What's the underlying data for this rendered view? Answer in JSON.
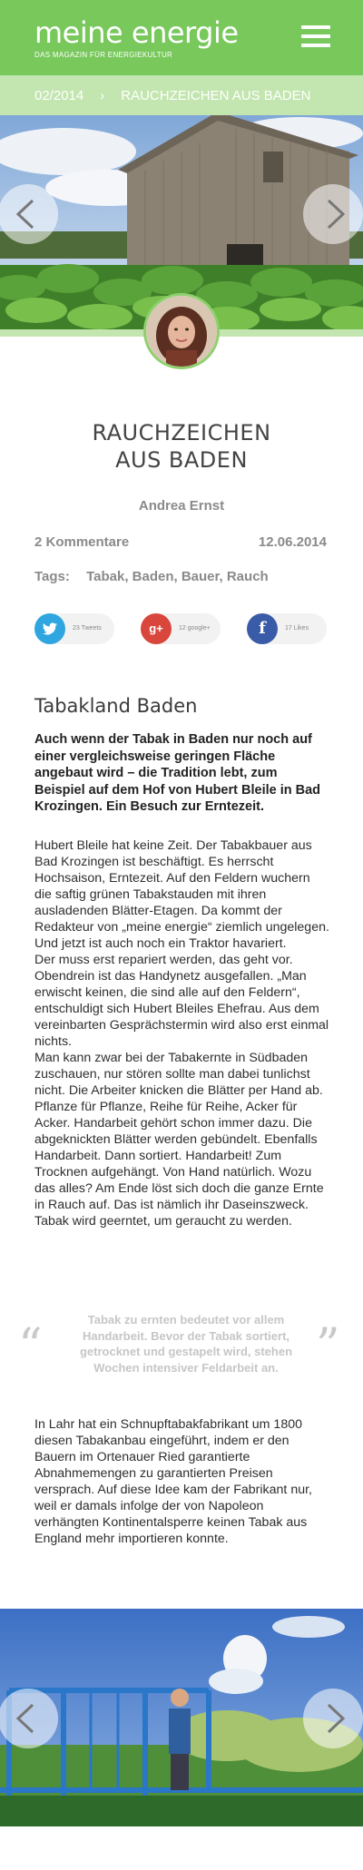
{
  "header": {
    "title": "meine energie",
    "subtitle": "DAS MAGAZIN FÜR ENERGIEKULTUR",
    "menu_icon": "hamburger-menu-icon"
  },
  "breadcrumb": {
    "issue": "02/2014",
    "separator": "›",
    "current": "RAUCHZEICHEN AUS BADEN"
  },
  "article": {
    "title_line1": "RAUCHZEICHEN",
    "title_line2": "AUS BADEN",
    "author": "Andrea Ernst",
    "comments": "2 Kommentare",
    "date": "12.06.2014",
    "tags_label": "Tags:",
    "tags": "Tabak, Baden, Bauer, Rauch"
  },
  "shares": [
    {
      "network": "twitter",
      "icon": "twitter-icon",
      "count": "23 Tweets",
      "color": "#2fa6e0"
    },
    {
      "network": "googleplus",
      "icon": "googleplus-icon",
      "count": "12 google+",
      "color": "#d9463b"
    },
    {
      "network": "facebook",
      "icon": "facebook-icon",
      "count": "17 Likes",
      "color": "#3a5ca8"
    }
  ],
  "section": {
    "heading": "Tabakland Baden",
    "lead": "Auch wenn der Tabak in Baden nur noch auf einer vergleichsweise geringen Fläche angebaut wird – die Tradition lebt, zum Beispiel auf dem Hof von Hubert Bleile in Bad Krozingen. Ein Besuch zur Erntezeit.",
    "body1": "Hubert Bleile hat keine Zeit. Der Tabakbauer aus Bad Krozingen ist beschäftigt. Es herrscht Hochsaison, Erntezeit. Auf den Feldern wuchern die saftig grünen Tabakstauden mit ihren ausladenden Blätter-Etagen. Da kommt der Redakteur von „meine energie“ ziemlich ungelegen. Und jetzt ist auch noch ein Traktor havariert.\nDer muss erst repariert werden, das geht vor. Obendrein ist das Handynetz ausgefallen. „Man erwischt keinen, die sind alle auf den Feldern“, entschuldigt sich Hubert Bleiles Ehefrau. Aus dem vereinbarten Gesprächstermin wird also erst einmal nichts.\nMan kann zwar bei der Tabakernte in Südbaden zuschauen, nur stören sollte man dabei tunlichst nicht. Die Arbeiter knicken die Blätter per Hand ab. Pflanze für Pflanze, Reihe für Reihe, Acker für Acker. Handarbeit gehört schon immer dazu. Die abgeknickten Blätter werden gebündelt. Ebenfalls Handarbeit. Dann sortiert. Handarbeit! Zum Trocknen aufgehängt. Von Hand natürlich. Wozu das alles? Am Ende löst sich doch die ganze Ernte in Rauch auf. Das ist nämlich ihr Daseinszweck. Tabak wird geerntet, um geraucht zu werden.",
    "quote": "Tabak zu ernten bedeutet vor allem Handarbeit. Bevor der Tabak sortiert, getrocknet und gestapelt wird, stehen Wochen intensiver Feldarbeit an.",
    "quote_open": "“",
    "quote_close": "”",
    "body2": "In Lahr hat ein Schnupftabakfabrikant um 1800 diesen Tabakanbau eingeführt, indem er den Bauern im Ortenauer Ried garantierte Abnahmemengen zu garantierten Preisen versprach. Auf diese Idee kam der Fabrikant nur, weil er damals infolge der von Napoleon verhängten Kontinentalsperre keinen Tabak aus England mehr importieren konnte."
  },
  "colors": {
    "brand_green": "#78c85c",
    "light_green": "#c3e6b0"
  }
}
